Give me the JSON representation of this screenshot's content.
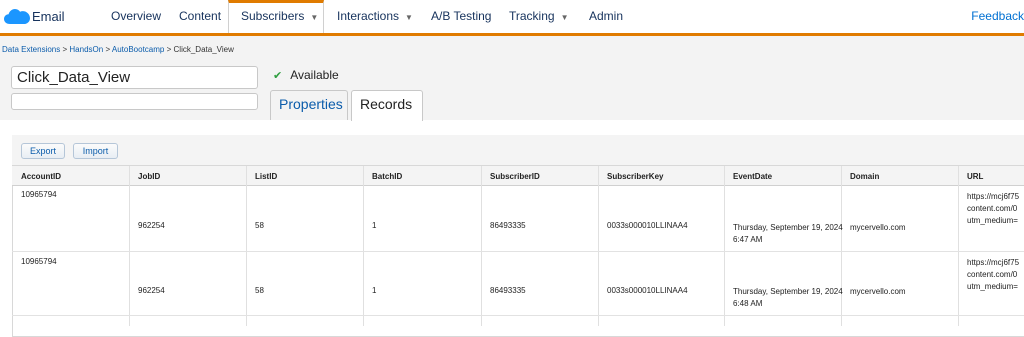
{
  "nav": {
    "brand": "Email",
    "items": [
      {
        "label": "Overview"
      },
      {
        "label": "Content"
      },
      {
        "label": "Subscribers"
      },
      {
        "label": "Interactions"
      },
      {
        "label": "A/B Testing"
      },
      {
        "label": "Tracking"
      },
      {
        "label": "Admin"
      }
    ],
    "feedback": "Feedback",
    "active": "Subscribers",
    "accent": "#e07b00"
  },
  "breadcrumb": [
    "Data Extensions",
    "HandsOn",
    "AutoBootcamp",
    "Click_Data_View"
  ],
  "breadcrumb_sep": ">",
  "extension": {
    "name": "Click_Data_View",
    "description": "",
    "status": "Available"
  },
  "tabs": [
    {
      "label": "Properties"
    },
    {
      "label": "Records"
    }
  ],
  "toolbar": {
    "export": "Export",
    "import": "Import"
  },
  "table": {
    "columns": [
      "AccountID",
      "JobID",
      "ListID",
      "BatchID",
      "SubscriberID",
      "SubscriberKey",
      "EventDate",
      "Domain",
      "URL"
    ],
    "rows": [
      {
        "AccountID": "10965794",
        "JobID": "962254",
        "ListID": "58",
        "BatchID": "1",
        "SubscriberID": "86493335",
        "SubscriberKey": "0033s000010LLINAA4",
        "EventDate": "Thursday, September 19, 2024 6:47 AM",
        "Domain": "mycervello.com",
        "URL": "https://mcj6f75\ncontent.com/0\nutm_medium="
      },
      {
        "AccountID": "10965794",
        "JobID": "962254",
        "ListID": "58",
        "BatchID": "1",
        "SubscriberID": "86493335",
        "SubscriberKey": "0033s000010LLINAA4",
        "EventDate": "Thursday, September 19, 2024 6:48 AM",
        "Domain": "mycervello.com",
        "URL": "https://mcj6f75\ncontent.com/0\nutm_medium="
      }
    ]
  }
}
